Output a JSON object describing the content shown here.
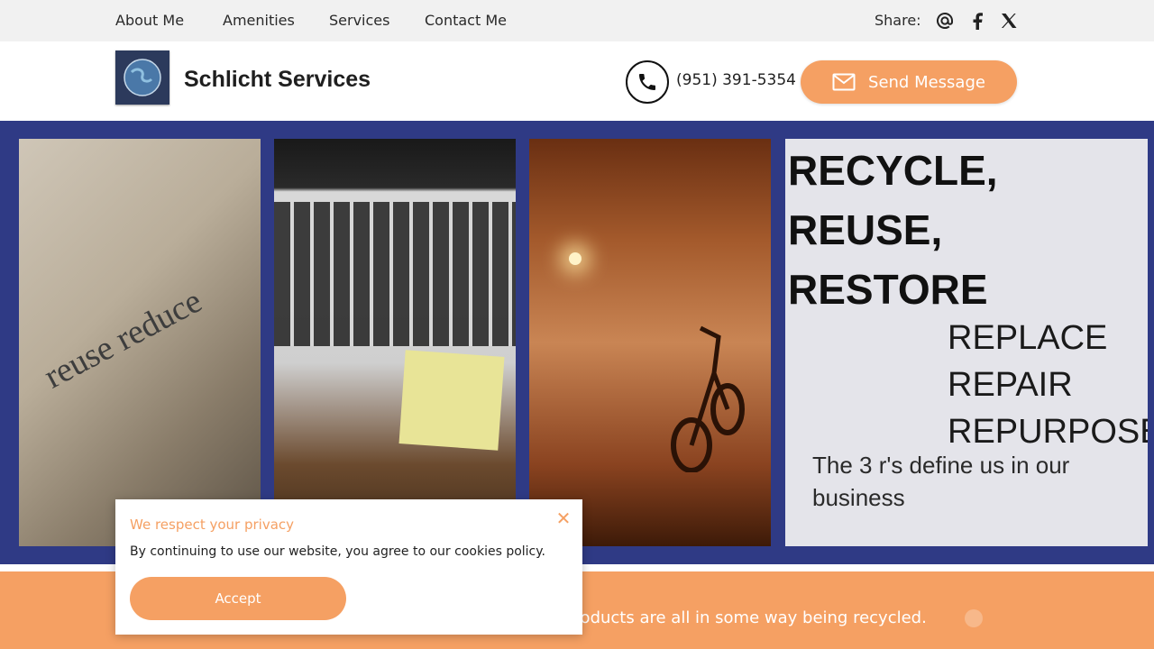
{
  "nav": {
    "items": [
      {
        "label": "About Me"
      },
      {
        "label": "Amenities"
      },
      {
        "label": "Services"
      },
      {
        "label": "Contact Me"
      }
    ],
    "share_label": "Share:",
    "share_icons": [
      "email-icon",
      "facebook-icon",
      "x-icon"
    ]
  },
  "header": {
    "brand": "Schlicht Services",
    "phone": "(951) 391-5354",
    "send_label": "Send Message"
  },
  "hero": {
    "panel1_text": "reuse reduce",
    "title_lines": [
      "RECYCLE,",
      "REUSE,",
      "RESTORE"
    ],
    "r_words": [
      "REPLACE",
      "REPAIR",
      "REPURPOSE"
    ],
    "tagline": "The 3 r's define us in our business"
  },
  "banner": {
    "text": "r products are all in some way being recycled."
  },
  "cookie": {
    "title": "We respect your privacy",
    "body": "By continuing to use our website, you agree to our cookies policy.",
    "accept_label": "Accept"
  },
  "colors": {
    "accent": "#f5a063",
    "hero_frame": "#2f3a85",
    "nav_bg": "#f1f1f1"
  }
}
